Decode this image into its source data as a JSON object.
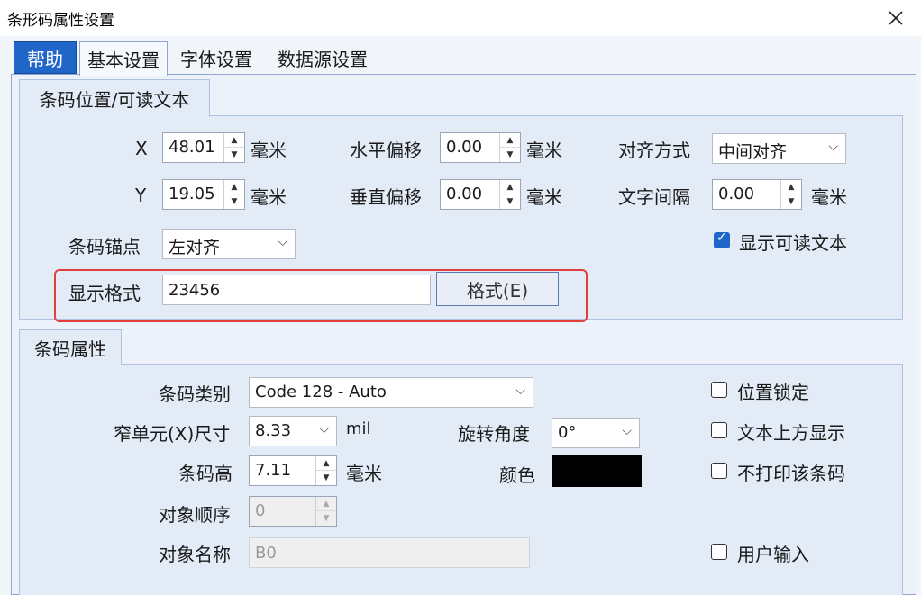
{
  "window": {
    "title": "条形码属性设置",
    "close_icon": "close-icon"
  },
  "tabs": [
    {
      "label": "帮助",
      "selected": false
    },
    {
      "label": "基本设置",
      "selected": true
    },
    {
      "label": "字体设置",
      "selected": false
    },
    {
      "label": "数据源设置",
      "selected": false
    }
  ],
  "position_group": {
    "title": "条码位置/可读文本",
    "x": {
      "label": "X",
      "value": "48.01",
      "unit": "毫米"
    },
    "y": {
      "label": "Y",
      "value": "19.05",
      "unit": "毫米"
    },
    "h_offset": {
      "label": "水平偏移",
      "value": "0.00",
      "unit": "毫米"
    },
    "v_offset": {
      "label": "垂直偏移",
      "value": "0.00",
      "unit": "毫米"
    },
    "align": {
      "label": "对齐方式",
      "value": "中间对齐"
    },
    "spacing": {
      "label": "文字间隔",
      "value": "0.00",
      "unit": "毫米"
    },
    "anchor": {
      "label": "条码锚点",
      "value": "左对齐"
    },
    "show_text": {
      "label": "显示可读文本",
      "checked": true
    },
    "format": {
      "label": "显示格式",
      "value": "23456",
      "button": "格式(E)"
    }
  },
  "barcode_group": {
    "title": "条码属性",
    "type": {
      "label": "条码类别",
      "value": "Code 128 - Auto"
    },
    "narrow": {
      "label": "窄单元(X)尺寸",
      "value": "8.33",
      "unit": "mil"
    },
    "rotation": {
      "label": "旋转角度",
      "value": "0°"
    },
    "height": {
      "label": "条码高",
      "value": "7.11",
      "unit": "毫米"
    },
    "color": {
      "label": "颜色",
      "value": "#000000"
    },
    "order": {
      "label": "对象顺序",
      "value": "0"
    },
    "name": {
      "label": "对象名称",
      "value": "B0"
    },
    "lock": {
      "label": "位置锁定",
      "checked": false
    },
    "text_above": {
      "label": "文本上方显示",
      "checked": false
    },
    "no_print": {
      "label": "不打印该条码",
      "checked": false
    },
    "user_input": {
      "label": "用户输入",
      "checked": false
    }
  },
  "colors": {
    "accent": "#1f66c8",
    "highlight_frame": "#e0403d",
    "panel_bg": "#e3ebf7"
  }
}
